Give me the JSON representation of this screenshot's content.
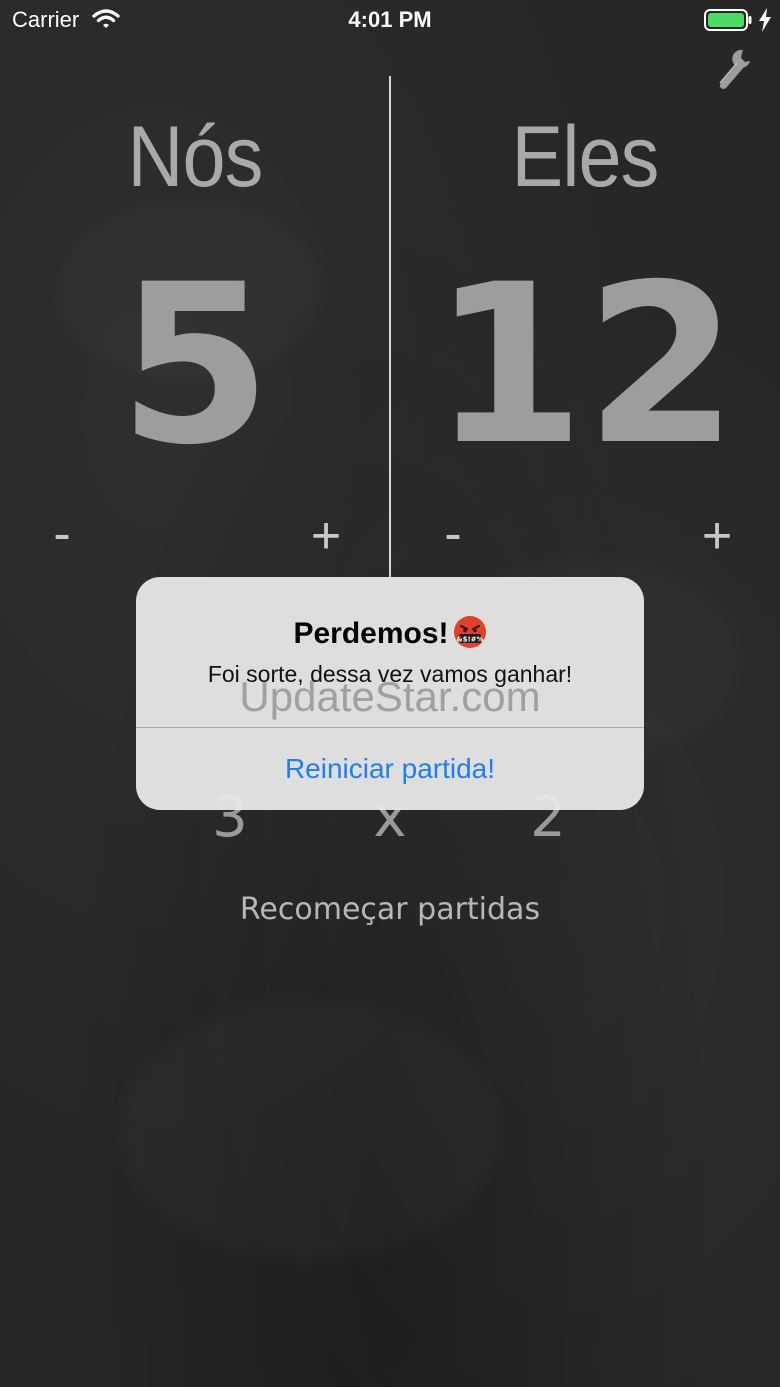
{
  "status_bar": {
    "carrier": "Carrier",
    "time": "4:01 PM"
  },
  "teams": {
    "left": {
      "name": "Nós",
      "score": "5",
      "minus_label": "-",
      "plus_label": "+"
    },
    "right": {
      "name": "Eles",
      "score": "12",
      "minus_label": "-",
      "plus_label": "+"
    }
  },
  "games": {
    "left": "3",
    "separator": "x",
    "right": "2"
  },
  "restart_label": "Recomeçar partidas",
  "alert": {
    "title": "Perdemos!",
    "message": "Foi sorte, dessa vez vamos ganhar!",
    "action_label": "Reiniciar partida!",
    "emoji": "enraged-face-with-symbols-emoji"
  },
  "watermark": "UpdateStar.com",
  "colors": {
    "background": "#272727",
    "chalk": "#a9a9a9",
    "alert_bg": "#e8e8e8",
    "alert_action": "#1f7ef0",
    "battery": "#4cd964",
    "emoji": "#e0412b"
  },
  "icons": {
    "settings": "wrench-icon",
    "wifi": "wifi-icon",
    "battery": "battery-icon",
    "charging": "bolt-icon"
  }
}
